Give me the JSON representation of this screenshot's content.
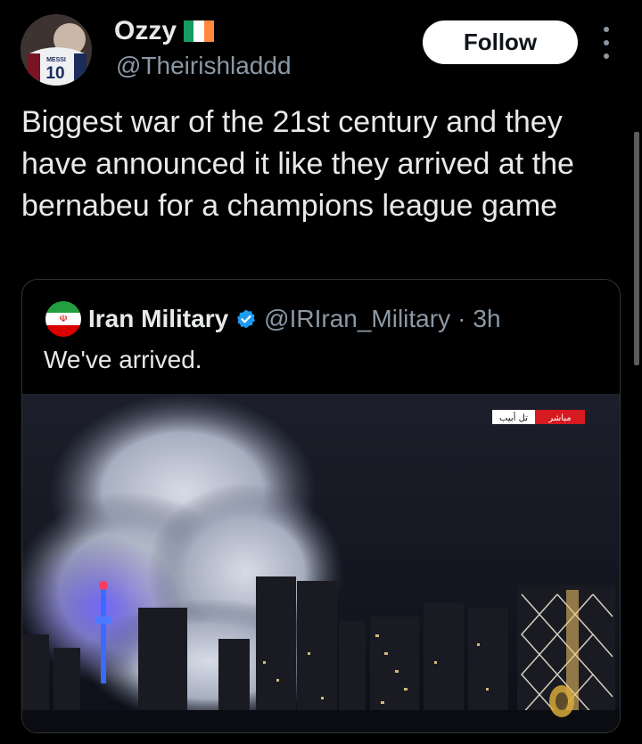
{
  "author": {
    "display_name": "Ozzy",
    "handle": "@Theirishladdd",
    "flag": "ireland-flag",
    "avatar_jersey_number": "10",
    "avatar_jersey_name": "MESSI"
  },
  "actions": {
    "follow_label": "Follow",
    "more_icon": "more-vertical-icon"
  },
  "tweet": {
    "text": "Biggest war of the 21st century and they have announced it like they arrived at the bernabeu for a champions league game"
  },
  "quoted_tweet": {
    "display_name": "Iran Military",
    "handle": "@IRIran_Military",
    "separator": "·",
    "time": "3h",
    "text": "We've arrived.",
    "flag": "iran-flag",
    "verified": true,
    "media": {
      "overlay_live": "مباشر",
      "overlay_location": "تل أبيب"
    }
  },
  "colors": {
    "background": "#000000",
    "text": "#e7e9ea",
    "secondary": "#8b98a5",
    "verified": "#1d9bf0",
    "border": "#2f3336"
  }
}
